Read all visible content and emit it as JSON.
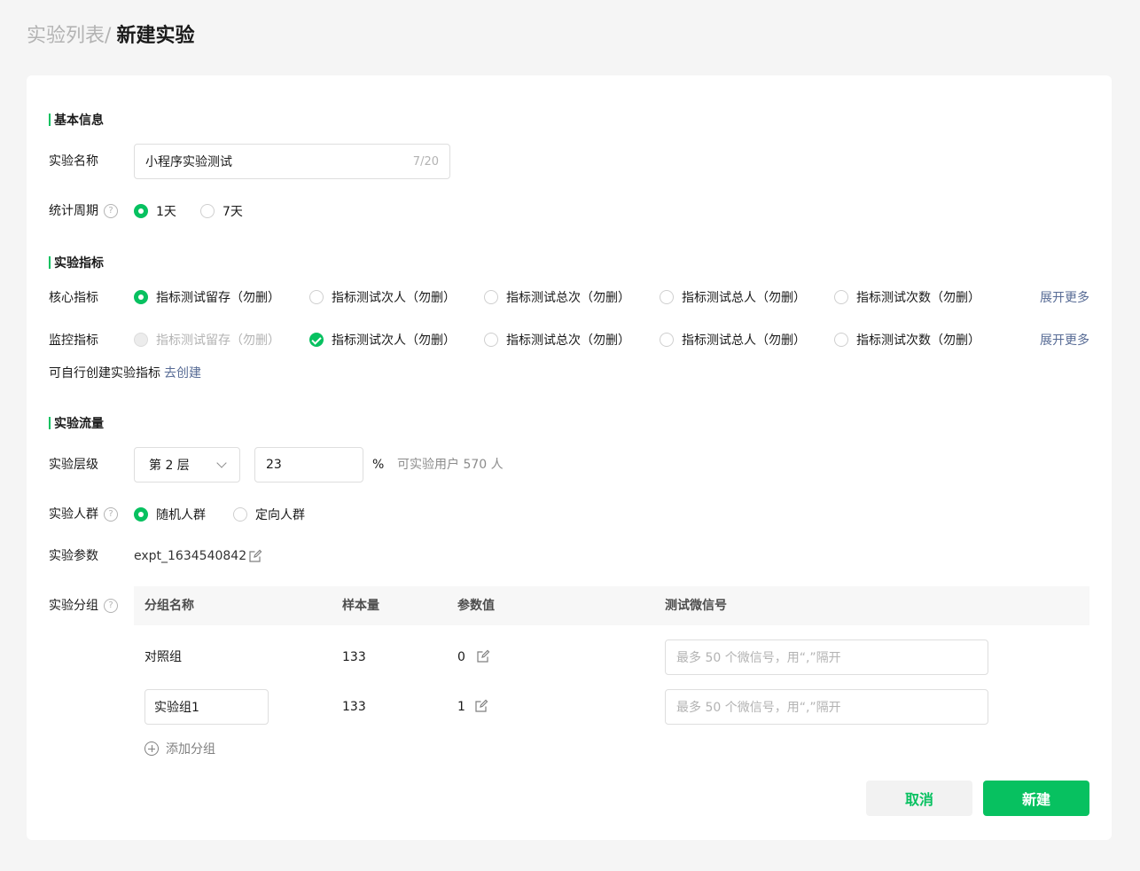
{
  "breadcrumb": {
    "prev": "实验列表",
    "sep": "/",
    "current": "新建实验"
  },
  "sections": {
    "basic": "基本信息",
    "metrics": "实验指标",
    "traffic": "实验流量"
  },
  "basic": {
    "name_label": "实验名称",
    "name_value": "小程序实验测试",
    "name_counter": "7/20",
    "period_label": "统计周期",
    "period_options": [
      "1天",
      "7天"
    ],
    "period_selected": "1天"
  },
  "metrics": {
    "core_label": "核心指标",
    "core_options": [
      "指标测试留存（勿删）",
      "指标测试次人（勿删）",
      "指标测试总次（勿删）",
      "指标测试总人（勿删）",
      "指标测试次数（勿删）"
    ],
    "core_selected": "指标测试留存（勿删）",
    "monitor_label": "监控指标",
    "monitor_options": [
      "指标测试留存（勿删）",
      "指标测试次人（勿删）",
      "指标测试总次（勿删）",
      "指标测试总人（勿删）",
      "指标测试次数（勿删）"
    ],
    "monitor_checked": "指标测试次人（勿删）",
    "monitor_disabled": "指标测试留存（勿删）",
    "expand_more": "展开更多",
    "create_hint": "可自行创建实验指标",
    "create_link": "去创建"
  },
  "traffic": {
    "layer_label": "实验层级",
    "layer_value": "第 2 层",
    "percent_value": "23",
    "percent_unit": "%",
    "available_users": "可实验用户 570 人",
    "audience_label": "实验人群",
    "audience_options": [
      "随机人群",
      "定向人群"
    ],
    "audience_selected": "随机人群",
    "param_label": "实验参数",
    "param_value": "expt_1634540842",
    "group_label": "实验分组"
  },
  "groups_table": {
    "headers": [
      "分组名称",
      "样本量",
      "参数值",
      "测试微信号"
    ],
    "rows": [
      {
        "name": "对照组",
        "samples": "133",
        "param": "0",
        "wechat_placeholder": "最多 50 个微信号，用“,”隔开"
      },
      {
        "name": "实验组1",
        "samples": "133",
        "param": "1",
        "wechat_placeholder": "最多 50 个微信号，用“,”隔开"
      }
    ],
    "add_group": "添加分组"
  },
  "actions": {
    "cancel": "取消",
    "create": "新建"
  },
  "colors": {
    "accent": "#07c160",
    "link": "#576b95",
    "page_bg": "#f5f5f5"
  }
}
